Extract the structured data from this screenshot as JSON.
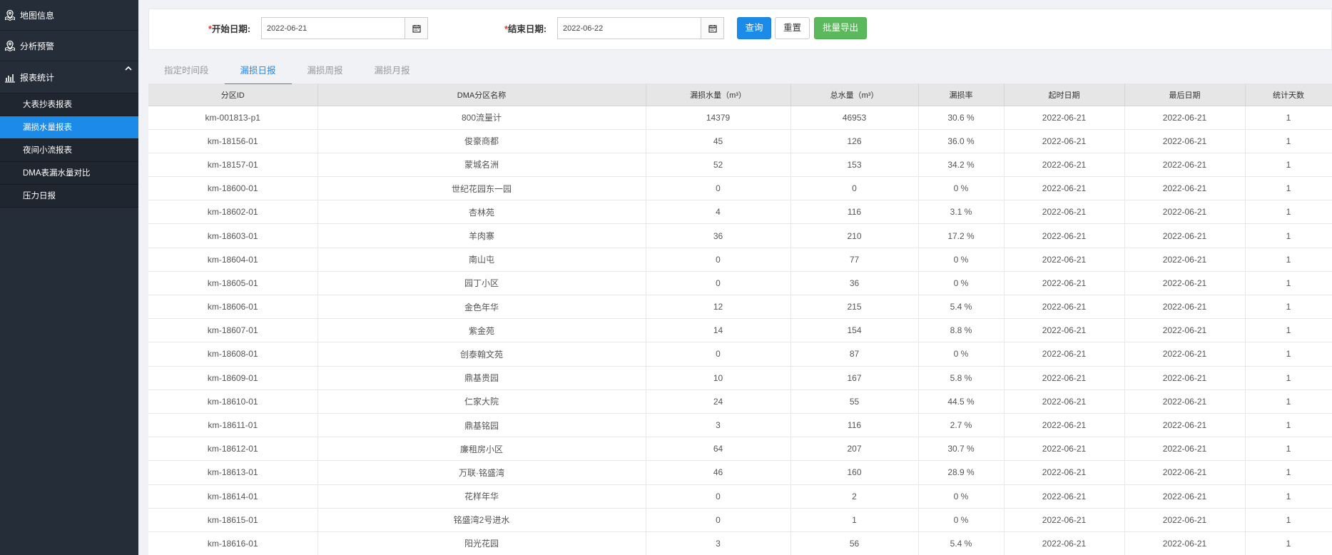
{
  "sidebar": {
    "nav": [
      {
        "label": "地图信息",
        "icon": "map-pin-icon"
      },
      {
        "label": "分析预警",
        "icon": "map-pin-icon"
      },
      {
        "label": "报表统计",
        "icon": "bar-chart-icon"
      }
    ],
    "sub_items": [
      {
        "label": "大表抄表报表",
        "active": false
      },
      {
        "label": "漏损水量报表",
        "active": true
      },
      {
        "label": "夜间小流报表",
        "active": false
      },
      {
        "label": "DMA表漏水量对比",
        "active": false
      },
      {
        "label": "压力日报",
        "active": false
      }
    ]
  },
  "filter": {
    "start_label": "开始日期:",
    "start_value": "2022-06-21",
    "end_label": "结束日期:",
    "end_value": "2022-06-22",
    "required_mark": "*",
    "query_label": "查询",
    "reset_label": "重置",
    "export_label": "批量导出"
  },
  "tabs": [
    {
      "label": "指定时间段",
      "active": false
    },
    {
      "label": "漏损日报",
      "active": true
    },
    {
      "label": "漏损周报",
      "active": false
    },
    {
      "label": "漏损月报",
      "active": false
    }
  ],
  "table": {
    "columns": [
      "分区ID",
      "DMA分区名称",
      "漏损水量（m³）",
      "总水量（m³）",
      "漏损率",
      "起时日期",
      "最后日期",
      "统计天数"
    ],
    "rows": [
      [
        "km-001813-p1",
        "800流量计",
        "14379",
        "46953",
        "30.6 %",
        "2022-06-21",
        "2022-06-21",
        "1"
      ],
      [
        "km-18156-01",
        "俊豪商都",
        "45",
        "126",
        "36.0 %",
        "2022-06-21",
        "2022-06-21",
        "1"
      ],
      [
        "km-18157-01",
        "蒙城名洲",
        "52",
        "153",
        "34.2 %",
        "2022-06-21",
        "2022-06-21",
        "1"
      ],
      [
        "km-18600-01",
        "世纪花园东一园",
        "0",
        "0",
        "0 %",
        "2022-06-21",
        "2022-06-21",
        "1"
      ],
      [
        "km-18602-01",
        "杏林苑",
        "4",
        "116",
        "3.1 %",
        "2022-06-21",
        "2022-06-21",
        "1"
      ],
      [
        "km-18603-01",
        "羊肉寨",
        "36",
        "210",
        "17.2 %",
        "2022-06-21",
        "2022-06-21",
        "1"
      ],
      [
        "km-18604-01",
        "南山屯",
        "0",
        "77",
        "0 %",
        "2022-06-21",
        "2022-06-21",
        "1"
      ],
      [
        "km-18605-01",
        "园丁小区",
        "0",
        "36",
        "0 %",
        "2022-06-21",
        "2022-06-21",
        "1"
      ],
      [
        "km-18606-01",
        "金色年华",
        "12",
        "215",
        "5.4 %",
        "2022-06-21",
        "2022-06-21",
        "1"
      ],
      [
        "km-18607-01",
        "紫金苑",
        "14",
        "154",
        "8.8 %",
        "2022-06-21",
        "2022-06-21",
        "1"
      ],
      [
        "km-18608-01",
        "创泰翰文苑",
        "0",
        "87",
        "0 %",
        "2022-06-21",
        "2022-06-21",
        "1"
      ],
      [
        "km-18609-01",
        "鼎基贵园",
        "10",
        "167",
        "5.8 %",
        "2022-06-21",
        "2022-06-21",
        "1"
      ],
      [
        "km-18610-01",
        "仁家大院",
        "24",
        "55",
        "44.5 %",
        "2022-06-21",
        "2022-06-21",
        "1"
      ],
      [
        "km-18611-01",
        "鼎基铭园",
        "3",
        "116",
        "2.7 %",
        "2022-06-21",
        "2022-06-21",
        "1"
      ],
      [
        "km-18612-01",
        "廉租房小区",
        "64",
        "207",
        "30.7 %",
        "2022-06-21",
        "2022-06-21",
        "1"
      ],
      [
        "km-18613-01",
        "万联·铭盛湾",
        "46",
        "160",
        "28.9 %",
        "2022-06-21",
        "2022-06-21",
        "1"
      ],
      [
        "km-18614-01",
        "花样年华",
        "0",
        "2",
        "0 %",
        "2022-06-21",
        "2022-06-21",
        "1"
      ],
      [
        "km-18615-01",
        "铭盛湾2号进水",
        "0",
        "1",
        "0 %",
        "2022-06-21",
        "2022-06-21",
        "1"
      ],
      [
        "km-18616-01",
        "阳光花园",
        "3",
        "56",
        "5.4 %",
        "2022-06-21",
        "2022-06-21",
        "1"
      ]
    ]
  }
}
